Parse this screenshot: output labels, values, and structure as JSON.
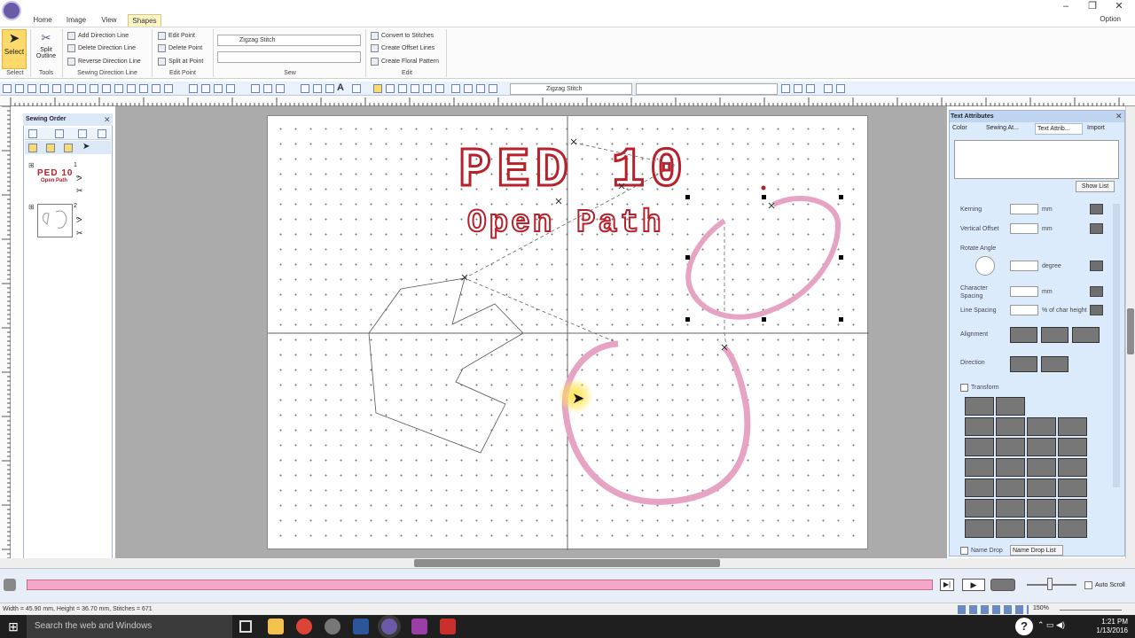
{
  "ribbon_tabs": [
    "Home",
    "Image",
    "View",
    "Shapes"
  ],
  "option_menu": "Option",
  "ribbon": {
    "select_label": "Select",
    "split_outline_label": "Split Outline",
    "groups": [
      "Select",
      "Tools",
      "Sewing Direction Line",
      "Edit Point",
      "Sew",
      "Edit"
    ],
    "direction_items": [
      "Add Direction Line",
      "Delete Direction Line",
      "Reverse Direction Line"
    ],
    "edit_point_items": [
      "Edit Point",
      "Delete Point",
      "Split at Point"
    ],
    "sew_combo_1": "Zigzag Stitch",
    "sew_combo_2": "",
    "edit_items": [
      "Convert to Stitches",
      "Create Offset Lines",
      "Create Floral Pattern"
    ]
  },
  "toolbar": {
    "stitch_combo": "Zigzag Stitch"
  },
  "sewing_order": {
    "title": "Sewing Order",
    "items": [
      {
        "index": "1",
        "preview_line1": "PED 10",
        "preview_line2": "Open Path"
      },
      {
        "index": "2",
        "preview_line1": "",
        "preview_line2": ""
      }
    ]
  },
  "canvas": {
    "text_line1": "PED 10",
    "text_line2": "Open Path"
  },
  "text_attributes": {
    "title": "Text Attributes",
    "tabs": [
      "Color",
      "Sewing At...",
      "Text Attrib...",
      "Import"
    ],
    "show_list": "Show List",
    "fields": [
      {
        "label": "Kerning",
        "unit": "mm"
      },
      {
        "label": "Vertical Offset",
        "unit": "mm"
      },
      {
        "label": "Rotate Angle",
        "unit": "degree"
      },
      {
        "label": "Character Spacing",
        "unit": "mm"
      },
      {
        "label": "Line Spacing",
        "unit": "% of char height"
      }
    ],
    "alignment": "Alignment",
    "direction": "Direction",
    "transform": "Transform",
    "name_drop": "Name Drop",
    "name_drop_list": "Name Drop List"
  },
  "simulator": {
    "auto_scroll": "Auto Scroll",
    "zoom": "150%"
  },
  "status": {
    "text": "Width = 45.90 mm, Height = 36.70 mm, Stitches = 671"
  },
  "taskbar": {
    "search_placeholder": "Search the web and Windows",
    "time": "1:21 PM",
    "date": "1/13/2016"
  },
  "colors": {
    "accent": "#fbd96a",
    "text_red": "#b8202a",
    "stitch_pink": "#e7a3c4"
  }
}
